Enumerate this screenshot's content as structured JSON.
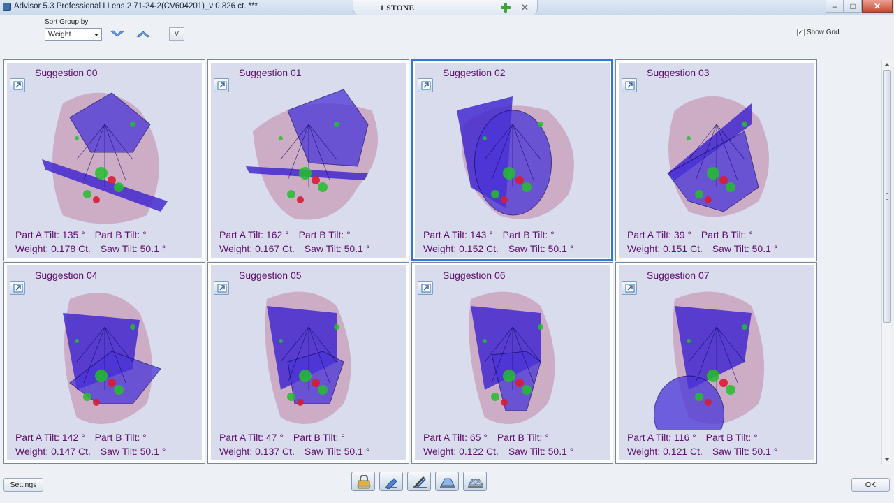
{
  "window": {
    "title": "Advisor 5.3 Professional I Lens 2    71-24-2(CV604201)_v   0.826 ct. ***",
    "tab_label": "1 STONE",
    "minimize": "–",
    "maximize": "□",
    "close": "✕"
  },
  "toolbar": {
    "sort_label": "Sort Group by",
    "sort_value": "Weight",
    "v_button": "V",
    "show_grid_label": "Show Grid",
    "show_grid_checked": "✓"
  },
  "labels": {
    "part_a": "Part A Tilt:",
    "part_b": "Part B Tilt:",
    "weight": "Weight:",
    "saw": "Saw Tilt:"
  },
  "suggestions": [
    {
      "title": "Suggestion 00",
      "part_a": "135 °",
      "part_b": "°",
      "weight": "0.178 Ct.",
      "saw": "50.1 °"
    },
    {
      "title": "Suggestion 01",
      "part_a": "162 °",
      "part_b": "°",
      "weight": "0.167 Ct.",
      "saw": "50.1 °"
    },
    {
      "title": "Suggestion 02",
      "part_a": "143 °",
      "part_b": "°",
      "weight": "0.152 Ct.",
      "saw": "50.1 °"
    },
    {
      "title": "Suggestion 03",
      "part_a": "39 °",
      "part_b": "°",
      "weight": "0.151 Ct.",
      "saw": "50.1 °"
    },
    {
      "title": "Suggestion 04",
      "part_a": "142 °",
      "part_b": "°",
      "weight": "0.147 Ct.",
      "saw": "50.1 °"
    },
    {
      "title": "Suggestion 05",
      "part_a": "47 °",
      "part_b": "°",
      "weight": "0.137 Ct.",
      "saw": "50.1 °"
    },
    {
      "title": "Suggestion 06",
      "part_a": "65 °",
      "part_b": "°",
      "weight": "0.122 Ct.",
      "saw": "50.1 °"
    },
    {
      "title": "Suggestion 07",
      "part_a": "116 °",
      "part_b": "°",
      "weight": "0.121 Ct.",
      "saw": "50.1 °"
    }
  ],
  "footer": {
    "settings_label": "Settings",
    "ok_label": "OK"
  },
  "colors": {
    "text_purple": "#5e0f6d",
    "card_bg": "#d9dcec",
    "selected_border": "#2f77e0",
    "stone_pink": "#e3a9a4",
    "stone_lavender": "#aaaaf0",
    "gem_blue": "#3a1fd0",
    "inclusion_green": "#22c02a",
    "inclusion_red": "#d81c34"
  },
  "icons": {
    "expand": "expand-icon",
    "sort_down": "chevron-down-icon",
    "sort_up": "chevron-up-icon",
    "add": "plus-icon",
    "close": "close-icon"
  }
}
